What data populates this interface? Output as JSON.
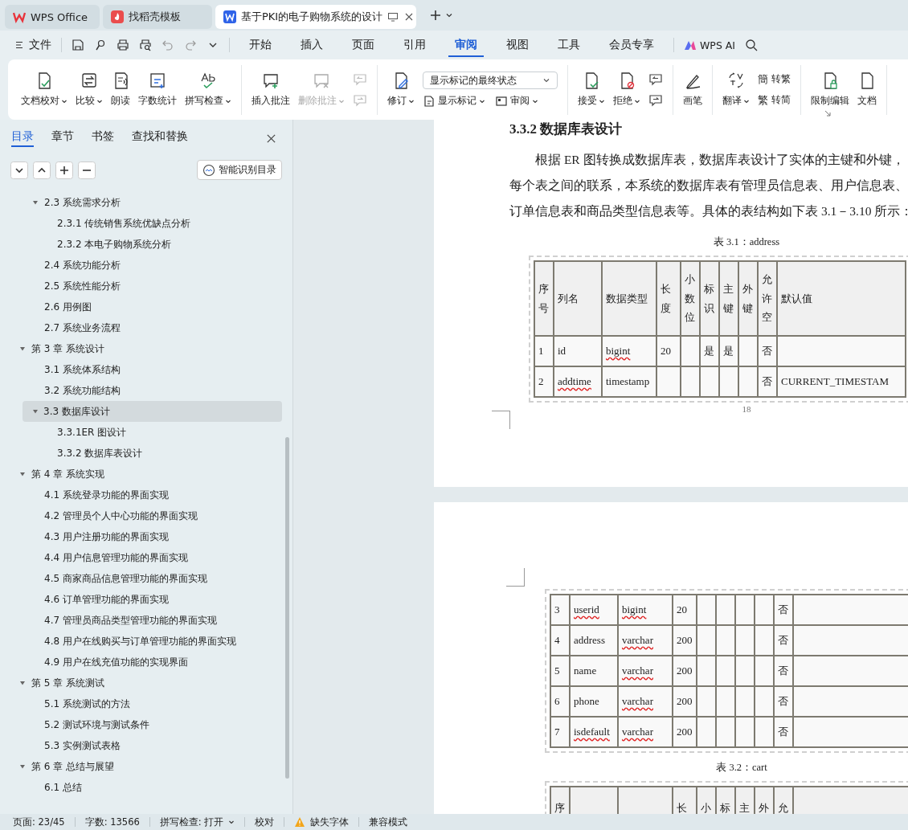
{
  "app_tabs": [
    {
      "kind": "home",
      "label": "WPS Office",
      "selected": false
    },
    {
      "kind": "template",
      "label": "找稻壳模板",
      "selected": false
    },
    {
      "kind": "document",
      "label": "基于PKI的电子购物系统的设计",
      "selected": true
    }
  ],
  "menu": {
    "file": "文件",
    "tabs": [
      {
        "label": "开始",
        "selected": false
      },
      {
        "label": "插入",
        "selected": false
      },
      {
        "label": "页面",
        "selected": false
      },
      {
        "label": "引用",
        "selected": false
      },
      {
        "label": "审阅",
        "selected": true
      },
      {
        "label": "视图",
        "selected": false
      },
      {
        "label": "工具",
        "selected": false
      },
      {
        "label": "会员专享",
        "selected": false
      }
    ],
    "ai": "WPS AI"
  },
  "ribbon": {
    "groups": [
      {
        "items": [
          {
            "kind": "large",
            "label": "文档校对",
            "dropdown": true,
            "disabled": false
          },
          {
            "kind": "large",
            "label": "比较",
            "dropdown": true,
            "disabled": false
          },
          {
            "kind": "large",
            "label": "朗读",
            "dropdown": false,
            "disabled": false
          },
          {
            "kind": "large",
            "label": "字数统计",
            "dropdown": false,
            "disabled": false
          },
          {
            "kind": "large",
            "label": "拼写检查",
            "dropdown": true,
            "disabled": false
          }
        ]
      },
      {
        "items": [
          {
            "kind": "large",
            "label": "插入批注",
            "dropdown": false,
            "disabled": false
          },
          {
            "kind": "large",
            "label": "删除批注",
            "dropdown": true,
            "disabled": true
          },
          {
            "kind": "icon_stack",
            "buttons": [
              {
                "disabled": true
              },
              {
                "disabled": true
              }
            ]
          }
        ]
      },
      {
        "items": [
          {
            "kind": "large",
            "label": "修订",
            "dropdown": true,
            "disabled": false
          },
          {
            "kind": "review_panel",
            "select": {
              "value": "显示标记的最终状态"
            },
            "buttons": [
              {
                "label": "显示标记",
                "dropdown": true
              },
              {
                "label": "审阅",
                "dropdown": true
              }
            ]
          }
        ]
      },
      {
        "items": [
          {
            "kind": "large",
            "label": "接受",
            "dropdown": true,
            "disabled": false
          },
          {
            "kind": "large",
            "label": "拒绝",
            "dropdown": true,
            "disabled": false
          },
          {
            "kind": "icon_stack",
            "buttons": [
              {
                "disabled": false
              },
              {
                "disabled": false
              }
            ]
          }
        ]
      },
      {
        "items": [
          {
            "kind": "large",
            "label": "画笔",
            "dropdown": false,
            "disabled": false
          }
        ]
      },
      {
        "items": [
          {
            "kind": "large",
            "label": "翻译",
            "dropdown": true,
            "disabled": false
          },
          {
            "kind": "text_stack",
            "buttons": [
              {
                "glyph": "簡",
                "label": "转繁"
              },
              {
                "glyph": "繁",
                "label": "转简"
              }
            ]
          }
        ]
      },
      {
        "items": [
          {
            "kind": "large",
            "label": "限制编辑",
            "dropdown": false,
            "disabled": false
          },
          {
            "kind": "large",
            "label": "文档",
            "dropdown": false,
            "disabled": false
          }
        ]
      }
    ]
  },
  "sidebar": {
    "tabs": [
      {
        "label": "目录",
        "selected": true
      },
      {
        "label": "章节",
        "selected": false
      },
      {
        "label": "书签",
        "selected": false
      },
      {
        "label": "查找和替换",
        "selected": false
      }
    ],
    "smart_toc": "智能识别目录",
    "outline": {
      "continued_section": [
        {
          "label": "2.3 系统需求分析",
          "expanded": true,
          "selected": false,
          "children": [
            {
              "label": "2.3.1 传统销售系统优缺点分析",
              "selected": false
            },
            {
              "label": "2.3.2 本电子购物系统分析",
              "selected": false
            }
          ]
        },
        {
          "label": "2.4 系统功能分析",
          "selected": false
        },
        {
          "label": "2.5 系统性能分析",
          "selected": false
        },
        {
          "label": "2.6 用例图",
          "selected": false
        },
        {
          "label": "2.7 系统业务流程",
          "selected": false
        }
      ],
      "chapters": [
        {
          "label": "第 3 章   系统设计",
          "expanded": true,
          "selected": false,
          "children": [
            {
              "label": "3.1 系统体系结构",
              "selected": false
            },
            {
              "label": "3.2 系统功能结构",
              "selected": false
            },
            {
              "label": "3.3 数据库设计",
              "expanded": true,
              "selected": true,
              "children": [
                {
                  "label": "3.3.1ER 图设计",
                  "selected": false
                },
                {
                  "label": "3.3.2 数据库表设计",
                  "selected": false
                }
              ]
            }
          ]
        },
        {
          "label": "第 4 章  系统实现",
          "expanded": true,
          "selected": false,
          "children": [
            {
              "label": "4.1 系统登录功能的界面实现",
              "selected": false
            },
            {
              "label": "4.2 管理员个人中心功能的界面实现",
              "selected": false
            },
            {
              "label": "4.3 用户注册功能的界面实现",
              "selected": false
            },
            {
              "label": "4.4 用户信息管理功能的界面实现",
              "selected": false
            },
            {
              "label": "4.5 商家商品信息管理功能的界面实现",
              "selected": false
            },
            {
              "label": "4.6 订单管理功能的界面实现",
              "selected": false
            },
            {
              "label": "4.7 管理员商品类型管理功能的界面实现",
              "selected": false
            },
            {
              "label": "4.8 用户在线购买与订单管理功能的界面实现",
              "selected": false
            },
            {
              "label": "4.9 用户在线充值功能的实现界面",
              "selected": false
            }
          ]
        },
        {
          "label": "第 5 章  系统测试",
          "expanded": true,
          "selected": false,
          "children": [
            {
              "label": "5.1 系统测试的方法",
              "selected": false
            },
            {
              "label": "5.2 测试环境与测试条件",
              "selected": false
            },
            {
              "label": "5.3 实例测试表格",
              "selected": false
            }
          ]
        },
        {
          "label": "第 6 章  总结与展望",
          "expanded": true,
          "selected": false,
          "children": [
            {
              "label": "6.1 总结",
              "selected": false
            }
          ]
        }
      ]
    }
  },
  "document": {
    "pages": [
      {
        "heading": "3.3.2 数据库表设计",
        "paragraph_lines": [
          "根据 ER 图转换成数据库表，数据库表设计了实体的主键和外键，",
          "每个表之间的联系，本系统的数据库表有管理员信息表、用户信息表、",
          "订单信息表和商品类型信息表等。具体的表结构如下表 3.1－3.10 所示："
        ],
        "tables": [
          {
            "caption": "表 3.1：address",
            "header": {
              "no": "序号",
              "name": "列名",
              "type": "数据类型",
              "length": "长度",
              "scale": "小数位",
              "identity": "标识",
              "primary": "主键",
              "foreign": "外键",
              "nullable": "允许空",
              "default": "默认值"
            },
            "rows": [
              {
                "no": "1",
                "name": "id",
                "name_misspelled": false,
                "type": "bigint",
                "type_misspelled": true,
                "length": "20",
                "identity": "是",
                "primary": "是",
                "nullable": "否"
              },
              {
                "no": "2",
                "name": "addtime",
                "name_misspelled": true,
                "type": "timestamp",
                "type_misspelled": false,
                "nullable": "否",
                "default": "CURRENT_TIMESTAM"
              }
            ]
          }
        ],
        "page_number": "18"
      },
      {
        "tables": [
          {
            "rows": [
              {
                "no": "3",
                "name": "userid",
                "name_misspelled": true,
                "type": "bigint",
                "type_misspelled": true,
                "length": "20",
                "nullable": "否"
              },
              {
                "no": "4",
                "name": "address",
                "name_misspelled": false,
                "type": "varchar",
                "type_misspelled": true,
                "length": "200",
                "nullable": "否"
              },
              {
                "no": "5",
                "name": "name",
                "name_misspelled": false,
                "type": "varchar",
                "type_misspelled": true,
                "length": "200",
                "nullable": "否"
              },
              {
                "no": "6",
                "name": "phone",
                "name_misspelled": false,
                "type": "varchar",
                "type_misspelled": true,
                "length": "200",
                "nullable": "否"
              },
              {
                "no": "7",
                "name": "isdefault",
                "name_misspelled": true,
                "type": "varchar",
                "type_misspelled": true,
                "length": "200",
                "nullable": "否"
              }
            ]
          },
          {
            "caption": "表 3.2：cart",
            "header": {
              "no": "序",
              "length": "长",
              "scale": "小",
              "identity": "标",
              "primary": "主",
              "foreign": "外",
              "nullable": "允"
            }
          }
        ]
      }
    ]
  },
  "status_bar": {
    "page": "页面: 23/45",
    "words": "字数: 13566",
    "spellcheck": "拼写检查: 打开",
    "proofread": "校对",
    "missing_fonts": "缺失字体",
    "compat": "兼容模式"
  }
}
